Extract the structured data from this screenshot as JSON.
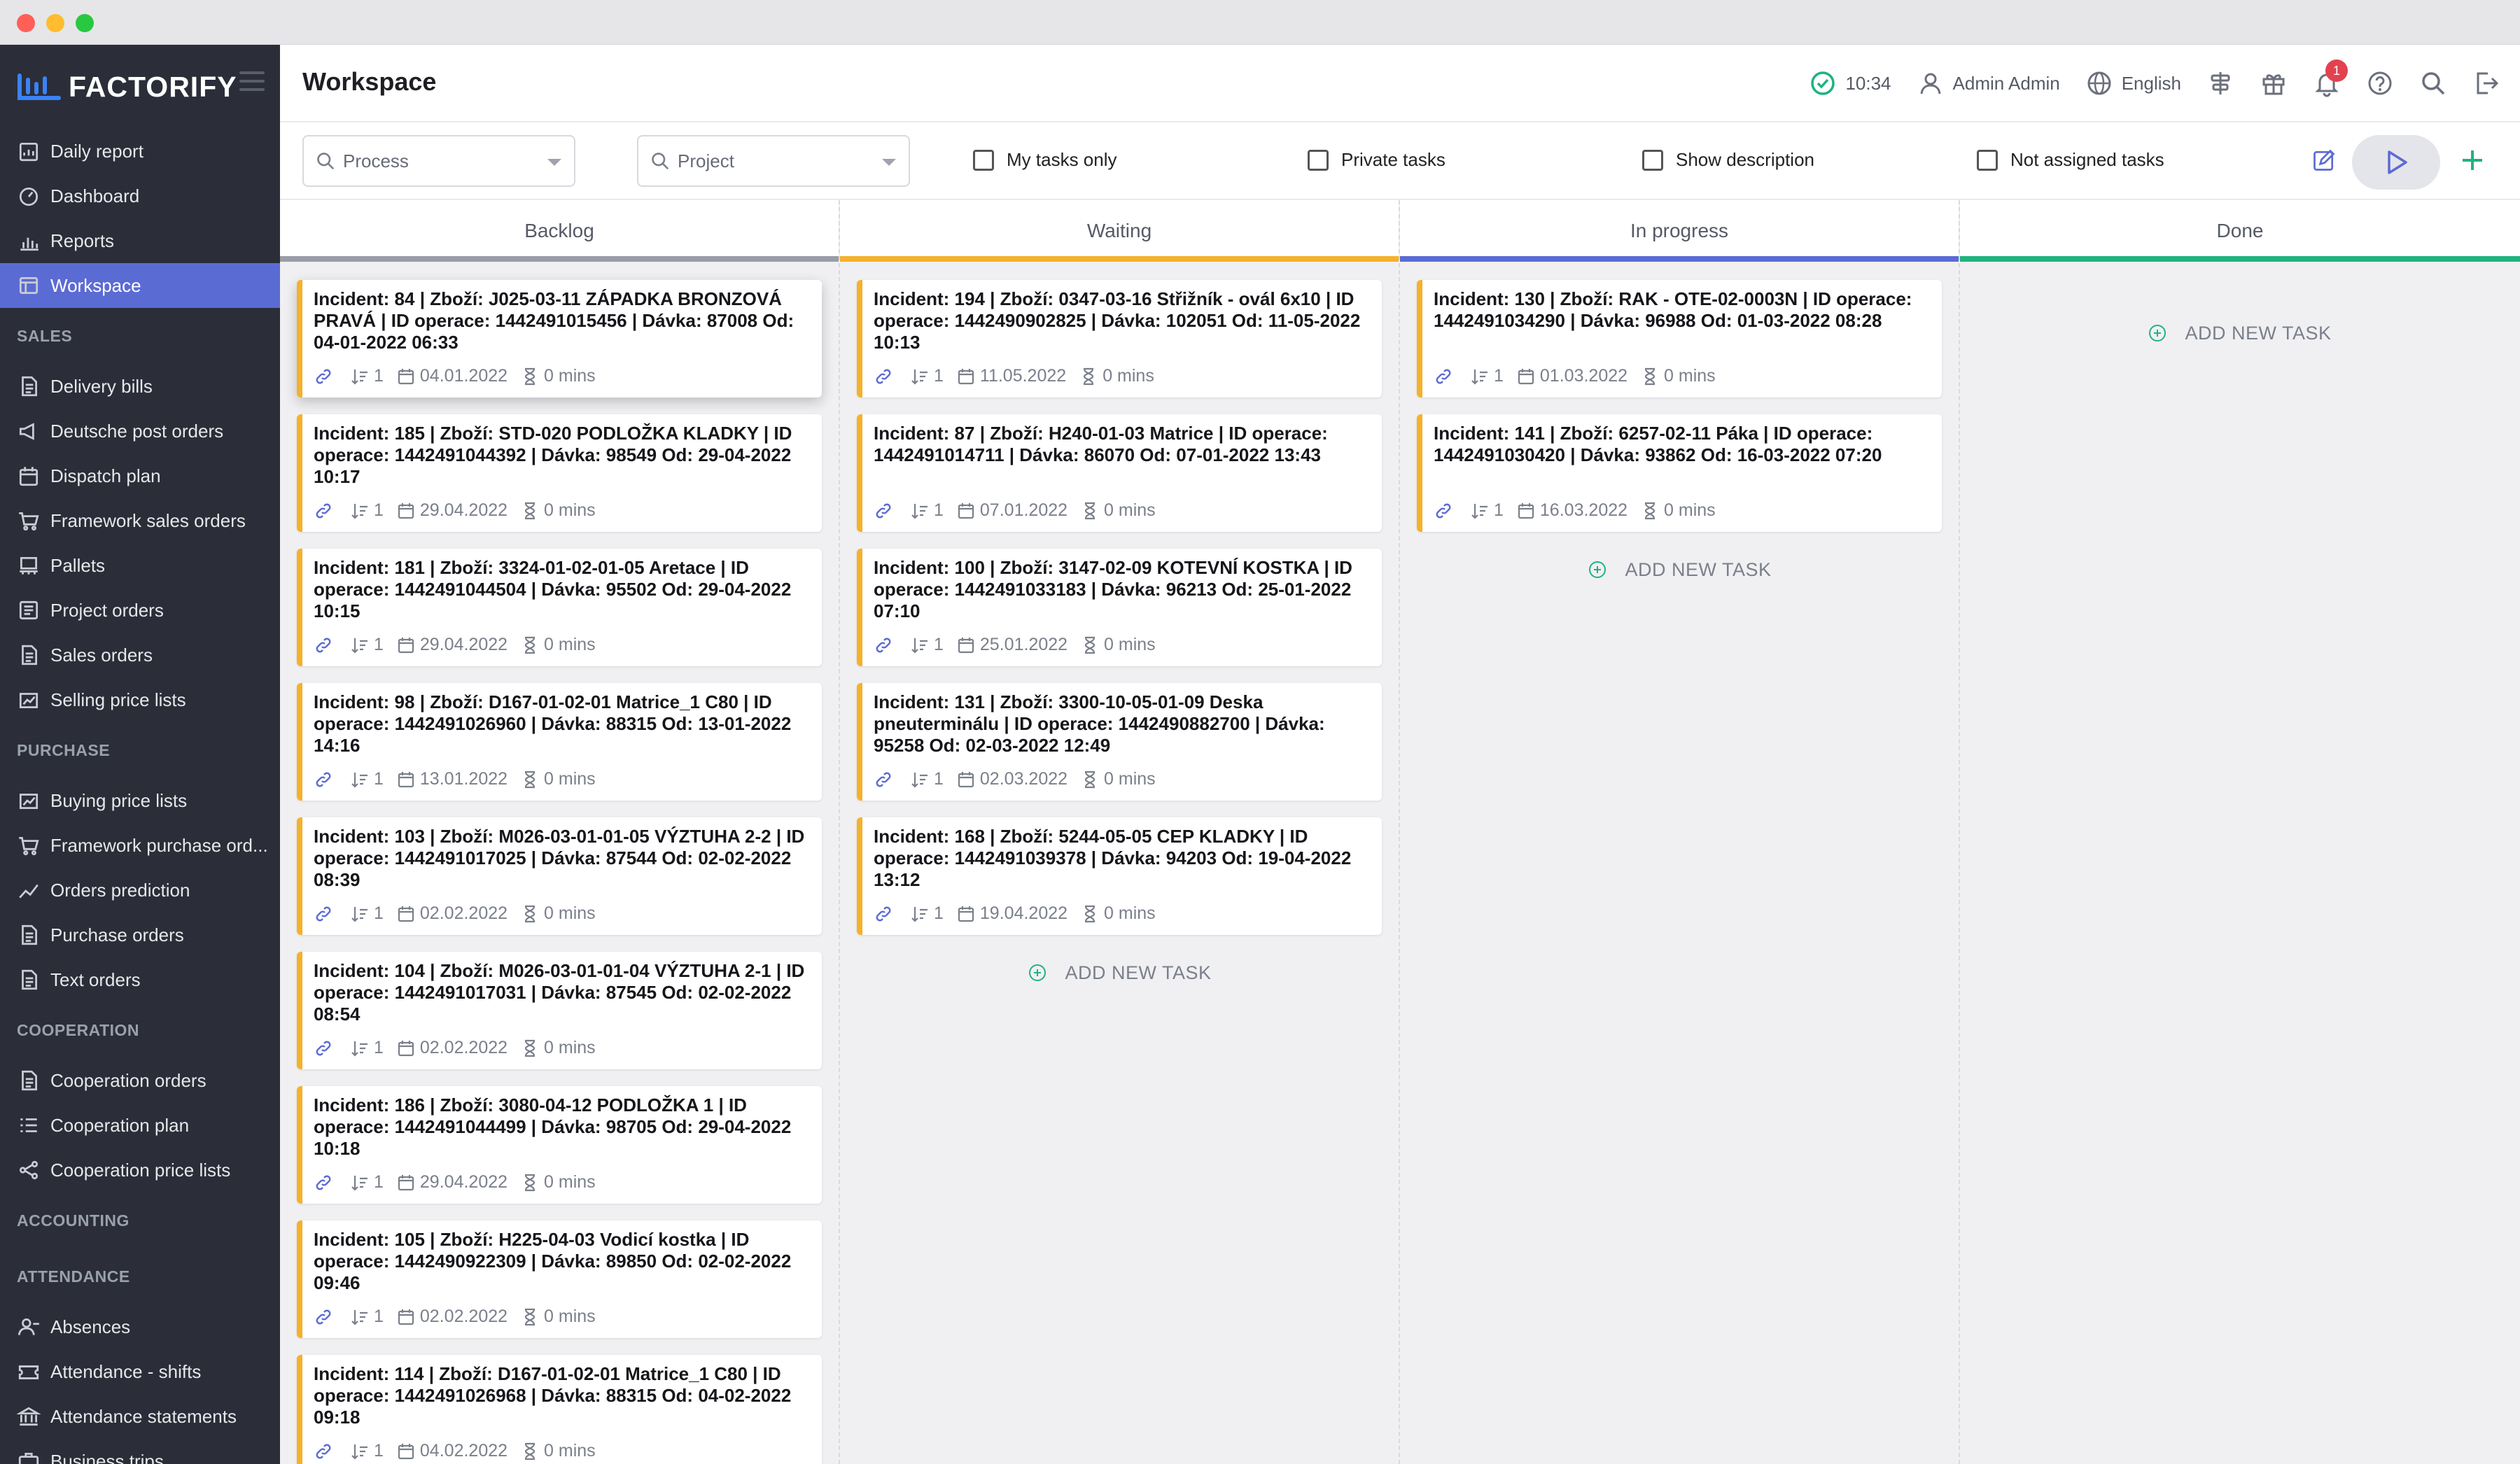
{
  "window": {
    "dots": [
      "#ff5f57",
      "#febc2e",
      "#28c840"
    ]
  },
  "brand": {
    "name": "FACTORIFY",
    "accent": "#3b82f6"
  },
  "sidebar": {
    "groups": [
      {
        "label": "",
        "items": [
          {
            "label": "Daily report",
            "icon": "document-chart-icon"
          },
          {
            "label": "Dashboard",
            "icon": "gauge-icon"
          },
          {
            "label": "Reports",
            "icon": "bar-chart-icon"
          },
          {
            "label": "Workspace",
            "icon": "workspace-icon",
            "active": true
          }
        ]
      },
      {
        "label": "SALES",
        "items": [
          {
            "label": "Delivery bills",
            "icon": "document-icon"
          },
          {
            "label": "Deutsche post orders",
            "icon": "megaphone-icon"
          },
          {
            "label": "Dispatch plan",
            "icon": "calendar-icon"
          },
          {
            "label": "Framework sales orders",
            "icon": "cart-icon"
          },
          {
            "label": "Pallets",
            "icon": "pallet-icon"
          },
          {
            "label": "Project orders",
            "icon": "project-icon"
          },
          {
            "label": "Sales orders",
            "icon": "document-icon"
          },
          {
            "label": "Selling price lists",
            "icon": "price-list-icon"
          }
        ]
      },
      {
        "label": "PURCHASE",
        "items": [
          {
            "label": "Buying price lists",
            "icon": "price-list-icon"
          },
          {
            "label": "Framework purchase ord...",
            "icon": "cart-icon"
          },
          {
            "label": "Orders prediction",
            "icon": "trend-icon"
          },
          {
            "label": "Purchase orders",
            "icon": "document-icon"
          },
          {
            "label": "Text orders",
            "icon": "document-icon"
          }
        ]
      },
      {
        "label": "COOPERATION",
        "items": [
          {
            "label": "Cooperation orders",
            "icon": "document-icon"
          },
          {
            "label": "Cooperation plan",
            "icon": "list-icon"
          },
          {
            "label": "Cooperation price lists",
            "icon": "share-icon"
          }
        ]
      },
      {
        "label": "ACCOUNTING",
        "items": []
      },
      {
        "label": "ATTENDANCE",
        "items": [
          {
            "label": "Absences",
            "icon": "user-minus-icon"
          },
          {
            "label": "Attendance - shifts",
            "icon": "ticket-icon"
          },
          {
            "label": "Attendance statements",
            "icon": "bank-icon"
          },
          {
            "label": "Business trips",
            "icon": "briefcase-icon"
          }
        ]
      }
    ]
  },
  "header": {
    "title": "Workspace",
    "time": "10:34",
    "user": "Admin Admin",
    "language": "English",
    "notifications": "1"
  },
  "toolbar": {
    "process_placeholder": "Process",
    "project_placeholder": "Project",
    "checkboxes": [
      "My tasks only",
      "Private tasks",
      "Show description",
      "Not assigned tasks"
    ]
  },
  "board": {
    "add_task_label": "ADD NEW TASK",
    "columns": [
      {
        "name": "Backlog",
        "color": "#9a9ca6",
        "cards": [
          {
            "title": "Incident: 84 | Zboží: J025-03-11 ZÁPADKA BRONZOVÁ PRAVÁ | ID operace: 1442491015456 | Dávka: 87008 Od: 04-01-2022 06:33",
            "links": "1",
            "date": "04.01.2022",
            "duration": "0 mins"
          },
          {
            "title": "Incident: 185 | Zboží: STD-020 PODLOŽKA KLADKY | ID operace: 1442491044392 | Dávka: 98549 Od: 29-04-2022 10:17",
            "links": "1",
            "date": "29.04.2022",
            "duration": "0 mins"
          },
          {
            "title": "Incident: 181 | Zboží: 3324-01-02-01-05 Aretace | ID operace: 1442491044504 | Dávka: 95502 Od: 29-04-2022 10:15",
            "links": "1",
            "date": "29.04.2022",
            "duration": "0 mins"
          },
          {
            "title": "Incident: 98 | Zboží: D167-01-02-01 Matrice_1 C80 | ID operace: 1442491026960 | Dávka: 88315 Od: 13-01-2022 14:16",
            "links": "1",
            "date": "13.01.2022",
            "duration": "0 mins"
          },
          {
            "title": "Incident: 103 | Zboží: M026-03-01-01-05 VÝZTUHA 2-2 | ID operace: 1442491017025 | Dávka: 87544 Od: 02-02-2022 08:39",
            "links": "1",
            "date": "02.02.2022",
            "duration": "0 mins"
          },
          {
            "title": "Incident: 104 | Zboží: M026-03-01-01-04 VÝZTUHA 2-1 | ID operace: 1442491017031 | Dávka: 87545 Od: 02-02-2022 08:54",
            "links": "1",
            "date": "02.02.2022",
            "duration": "0 mins"
          },
          {
            "title": "Incident: 186 | Zboží: 3080-04-12 PODLOŽKA 1 | ID operace: 1442491044499 | Dávka: 98705 Od: 29-04-2022 10:18",
            "links": "1",
            "date": "29.04.2022",
            "duration": "0 mins"
          },
          {
            "title": "Incident: 105 | Zboží: H225-04-03 Vodicí kostka | ID operace: 1442490922309 | Dávka: 89850 Od: 02-02-2022 09:46",
            "links": "1",
            "date": "02.02.2022",
            "duration": "0 mins"
          },
          {
            "title": "Incident: 114 | Zboží: D167-01-02-01 Matrice_1 C80 | ID operace: 1442491026968 | Dávka: 88315 Od: 04-02-2022 09:18",
            "links": "1",
            "date": "04.02.2022",
            "duration": "0 mins"
          }
        ]
      },
      {
        "name": "Waiting",
        "color": "#f5b12b",
        "cards": [
          {
            "title": "Incident: 194 | Zboží: 0347-03-16 Střižník - ovál 6x10 | ID operace: 1442490902825 | Dávka: 102051 Od: 11-05-2022 10:13",
            "links": "1",
            "date": "11.05.2022",
            "duration": "0 mins"
          },
          {
            "title": "Incident: 87 | Zboží: H240-01-03 Matrice | ID operace: 1442491014711 | Dávka: 86070 Od: 07-01-2022 13:43",
            "links": "1",
            "date": "07.01.2022",
            "duration": "0 mins"
          },
          {
            "title": "Incident: 100 | Zboží: 3147-02-09 KOTEVNÍ KOSTKA | ID operace: 1442491033183 | Dávka: 96213 Od: 25-01-2022 07:10",
            "links": "1",
            "date": "25.01.2022",
            "duration": "0 mins"
          },
          {
            "title": "Incident: 131 | Zboží: 3300-10-05-01-09 Deska pneuterminálu | ID operace: 1442490882700 | Dávka: 95258 Od: 02-03-2022 12:49",
            "links": "1",
            "date": "02.03.2022",
            "duration": "0 mins"
          },
          {
            "title": "Incident: 168 | Zboží: 5244-05-05 CEP KLADKY | ID operace: 1442491039378 | Dávka: 94203 Od: 19-04-2022 13:12",
            "links": "1",
            "date": "19.04.2022",
            "duration": "0 mins"
          }
        ]
      },
      {
        "name": "In progress",
        "color": "#5b6bd4",
        "cards": [
          {
            "title": "Incident: 130 | Zboží: RAK - OTE-02-0003N | ID operace: 1442491034290 | Dávka: 96988 Od: 01-03-2022 08:28",
            "links": "1",
            "date": "01.03.2022",
            "duration": "0 mins"
          },
          {
            "title": "Incident: 141 | Zboží: 6257-02-11 Páka | ID operace: 1442491030420 | Dávka: 93862 Od: 16-03-2022 07:20",
            "links": "1",
            "date": "16.03.2022",
            "duration": "0 mins"
          }
        ]
      },
      {
        "name": "Done",
        "color": "#1fb37f",
        "cards": []
      }
    ]
  }
}
